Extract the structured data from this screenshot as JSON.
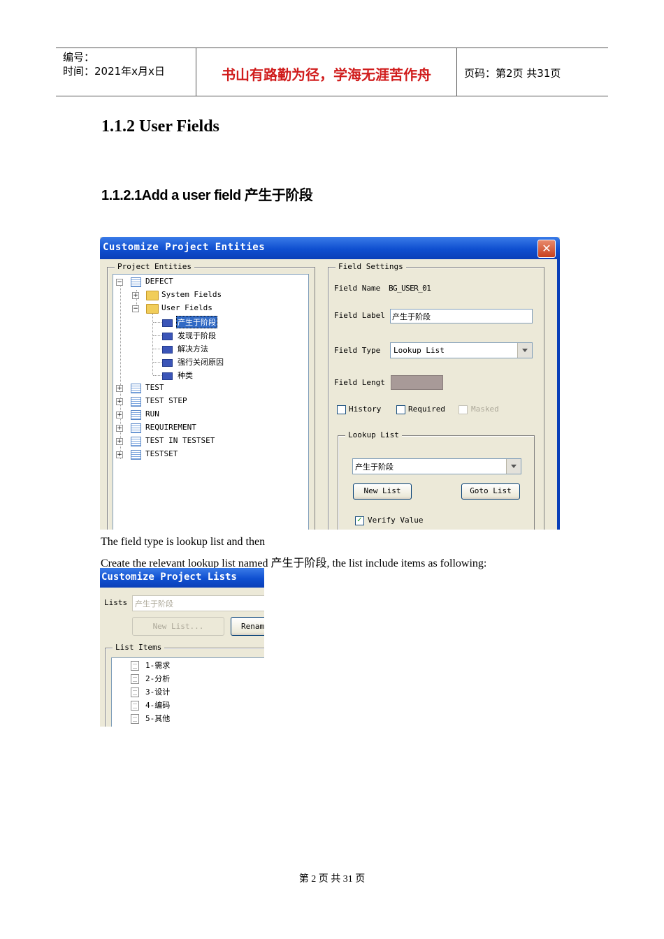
{
  "header": {
    "number_label": "编号：",
    "date_line": "时间：2021年x月x日",
    "motto": "书山有路勤为径，学海无涯苦作舟",
    "page_info": "页码：第2页  共31页"
  },
  "section_title": "1.1.2 User Fields",
  "subsection_title": "1.1.2.1Add a user field 产生于阶段",
  "dialog1": {
    "title": "Customize Project Entities",
    "close_icon": "close-icon",
    "project_entities_label": "Project Entities",
    "tree": {
      "defect": "DEFECT",
      "system_fields": "System Fields",
      "user_fields": "User Fields",
      "user_field_items": [
        "产生于阶段",
        "发现于阶段",
        "解决方法",
        "强行关闭原因",
        "种类"
      ],
      "entities": [
        "TEST",
        "TEST STEP",
        "RUN",
        "REQUIREMENT",
        "TEST IN TESTSET",
        "TESTSET"
      ]
    },
    "field_settings_label": "Field Settings",
    "field_name_label": "Field Name",
    "field_name_value": "BG_USER_01",
    "field_label_label": "Field Label",
    "field_label_value": "产生于阶段",
    "field_type_label": "Field Type",
    "field_type_value": "Lookup List",
    "field_length_label": "Field Lengt",
    "history_label": "History",
    "required_label": "Required",
    "masked_label": "Masked",
    "lookup_list_label": "Lookup List",
    "lookup_list_value": "产生于阶段",
    "new_list_button": "New List",
    "goto_list_button": "Goto List",
    "verify_value_label": "Verify Value"
  },
  "paragraph1": "The field type is lookup list and then",
  "paragraph2": "Create the relevant lookup list named 产生于阶段, the list include items as following:",
  "dialog2": {
    "title": "Customize Project Lists",
    "lists_label": "Lists",
    "lists_value": "产生于阶段",
    "new_list_button": "New List...",
    "rename_button": "Renam",
    "list_items_label": "List Items",
    "items": [
      "1-需求",
      "2-分析",
      "3-设计",
      "4-编码",
      "5-其他"
    ]
  },
  "footer": "第 2 页 共 31 页"
}
